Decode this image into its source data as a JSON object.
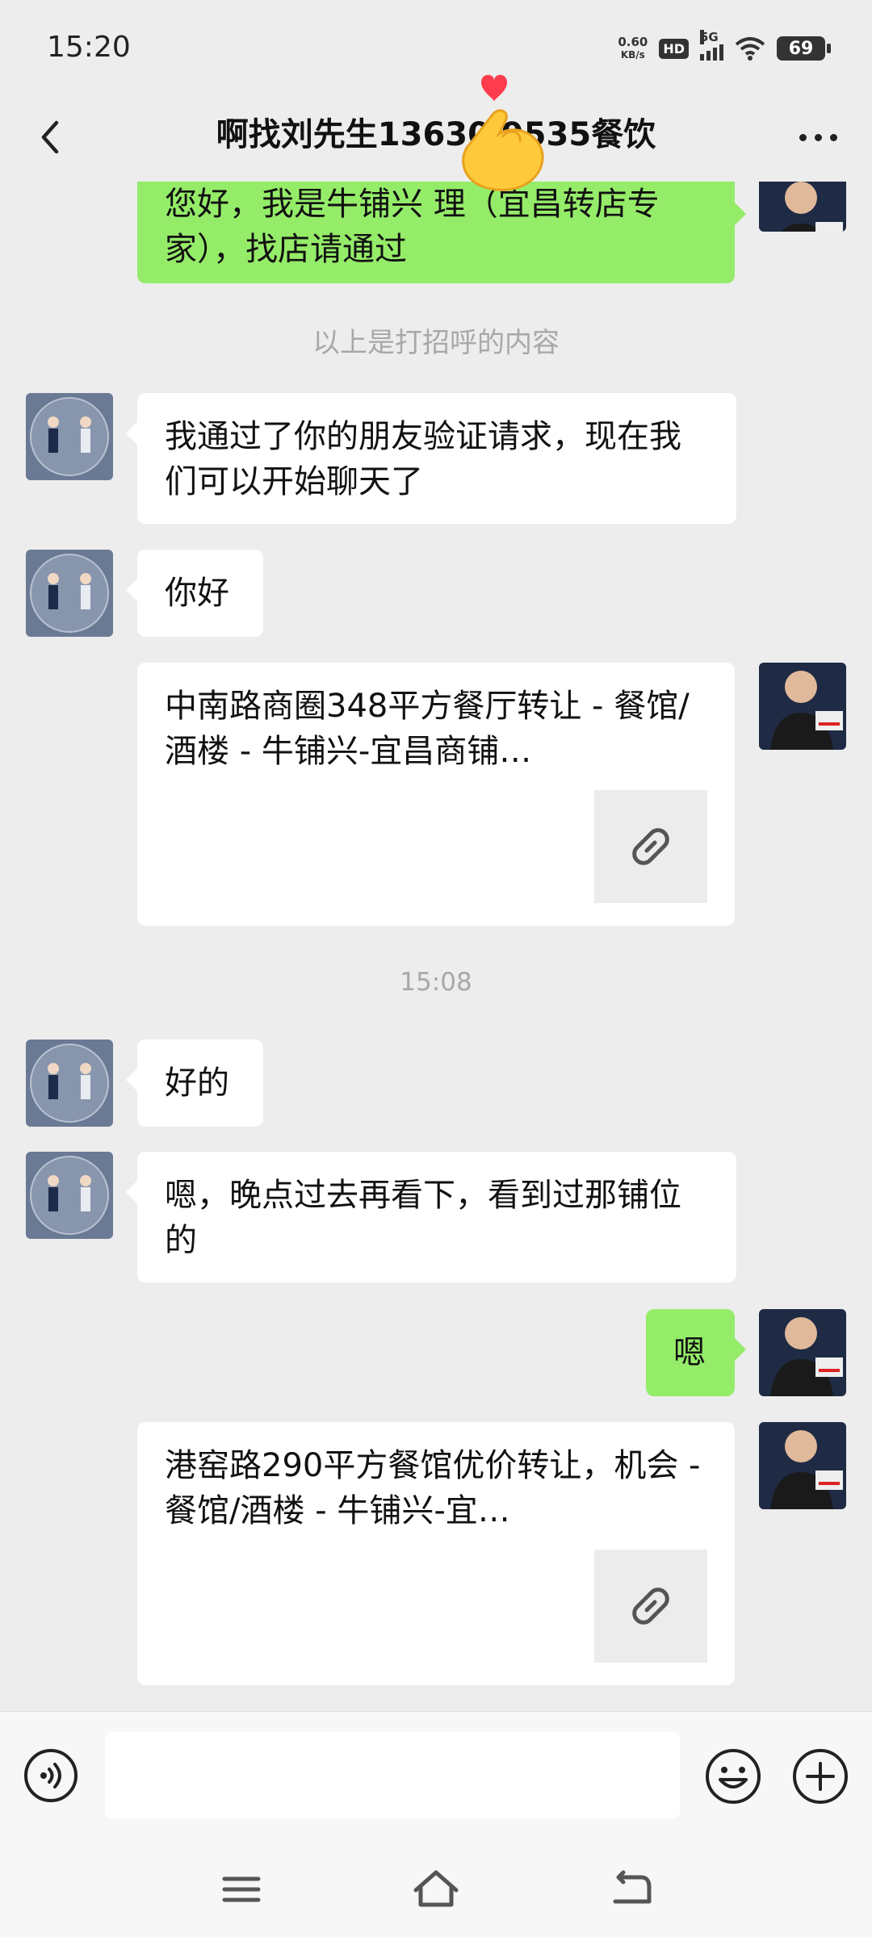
{
  "status": {
    "time": "15:20",
    "net_speed_value": "0.60",
    "net_speed_unit": "KB/s",
    "hd": "HD",
    "network": "5G",
    "battery": "69"
  },
  "header": {
    "title": "啊找刘先生13630 9535餐饮"
  },
  "messages": {
    "m1": "您好，我是牛铺兴 理（宜昌转店专家），找店请通过",
    "sys1": "以上是打招呼的内容",
    "m2": "我通过了你的朋友验证请求，现在我们可以开始聊天了",
    "m3": "你好",
    "card1": "中南路商圈348平方餐厅转让 - 餐馆/酒楼 - 牛铺兴-宜昌商铺…",
    "time1": "15:08",
    "m4": "好的",
    "m5": "嗯，晚点过去再看下，看到过那铺位的",
    "m6": "嗯",
    "card2": "港窑路290平方餐馆优价转让，机会 - 餐馆/酒楼 - 牛铺兴-宜…"
  },
  "icons": {
    "back": "chevron-left-icon",
    "more": "more-icon",
    "voice": "voice-icon",
    "emoji": "emoji-icon",
    "plus": "plus-icon",
    "link": "link-icon",
    "nav": [
      "menu-icon",
      "home-icon",
      "back-icon"
    ]
  },
  "colors": {
    "background": "#ededed",
    "outgoing_bubble": "#95ec69",
    "incoming_bubble": "#ffffff"
  }
}
